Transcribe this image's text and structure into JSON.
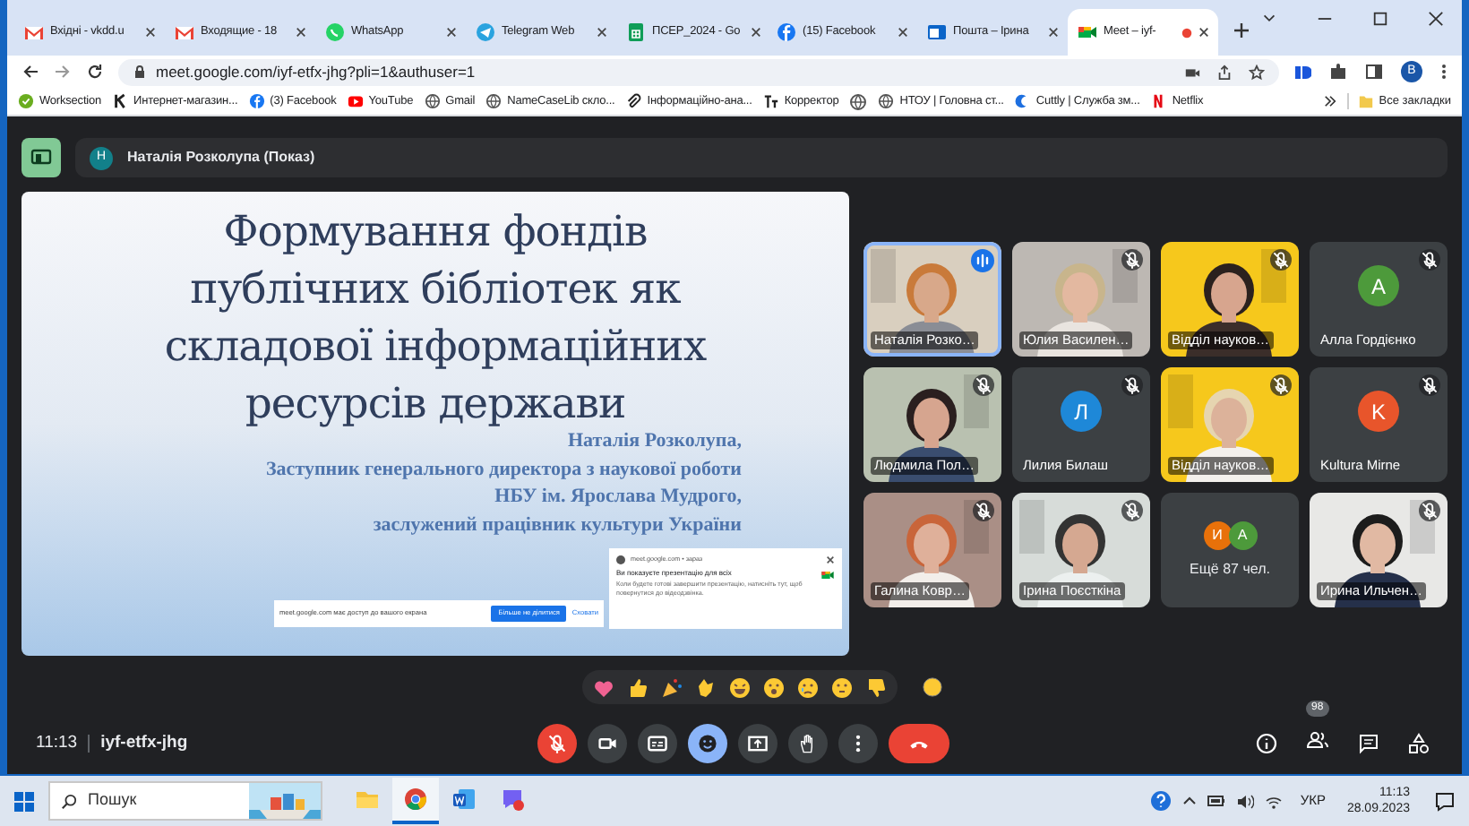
{
  "browser": {
    "tabs": [
      {
        "title": "Вхідні - vkdd.u",
        "selected": false
      },
      {
        "title": "Входящие - 18",
        "selected": false
      },
      {
        "title": "WhatsApp",
        "selected": false
      },
      {
        "title": "Telegram Web",
        "selected": false
      },
      {
        "title": "ПСЕР_2024 - Go",
        "selected": false
      },
      {
        "title": "(15) Facebook",
        "selected": false
      },
      {
        "title": "Пошта – Ірина",
        "selected": false
      },
      {
        "title": "Meet – iyf-",
        "selected": true
      }
    ],
    "url": "meet.google.com/iyf-etfx-jhg?pli=1&authuser=1",
    "profile_initial": "B",
    "bookmarks": [
      {
        "kind": "link",
        "title": "Worksection"
      },
      {
        "kind": "link",
        "title": "Интернет-магазин..."
      },
      {
        "kind": "link",
        "title": "(3) Facebook"
      },
      {
        "kind": "link",
        "title": "YouTube"
      },
      {
        "kind": "link",
        "title": "Gmail"
      },
      {
        "kind": "link",
        "title": "NameCaseLib скло..."
      },
      {
        "kind": "link",
        "title": "Інформаційно-ана..."
      },
      {
        "kind": "link",
        "title": "Корректор"
      },
      {
        "kind": "icon"
      },
      {
        "kind": "link",
        "title": "НТОУ | Головна ст..."
      },
      {
        "kind": "link",
        "title": "Cuttly | Служба зм..."
      },
      {
        "kind": "link",
        "title": "Netflix"
      }
    ],
    "all_bookmarks": "Все закладки"
  },
  "meet": {
    "presenter": {
      "initial": "Н",
      "name": "Наталія Розколупа (Показ)"
    },
    "slide": {
      "title": "Формування фондів\nпублічних бібліотек як\nскладової інформаційних\nресурсів держави",
      "subtitle": "Наталія Розколупа,\nЗаступник генерального директора з наукової роботи\nНБУ ім. Ярослава Мудрого,\nзаслужений працівник культури України"
    },
    "share_bar": {
      "text": "meet.google.com має доступ до вашого екрана",
      "stop": "Більше не ділитися",
      "hide": "Сховати"
    },
    "notification": {
      "source": "meet.google.com • зараз",
      "title": "Ви показуєте презентацію для всіх",
      "body": "Коли будете готові завершити презентацію, натисніть тут, щоб повернутися до відеодзвінка."
    },
    "tiles": [
      {
        "kind": "video",
        "name": "Наталія Розко…",
        "speaking": true,
        "muted": false
      },
      {
        "kind": "video",
        "name": "Юлия Василен…",
        "speaking": false,
        "muted": true
      },
      {
        "kind": "video",
        "name": "Відділ науков…",
        "speaking": false,
        "muted": true
      },
      {
        "kind": "avatar",
        "name": "Алла Гордієнко",
        "initial": "А",
        "color": "#4d9a3b",
        "speaking": false,
        "muted": true
      },
      {
        "kind": "video",
        "name": "Людмила Пол…",
        "speaking": false,
        "muted": true
      },
      {
        "kind": "avatar",
        "name": "Лилия Билаш",
        "initial": "Л",
        "color": "#1e88d8",
        "speaking": false,
        "muted": true
      },
      {
        "kind": "video",
        "name": "Відділ науков…",
        "speaking": false,
        "muted": true
      },
      {
        "kind": "avatar",
        "name": "Kultura Mirne",
        "initial": "K",
        "color": "#e8552b",
        "speaking": false,
        "muted": true
      },
      {
        "kind": "video",
        "name": "Галина Ковр…",
        "speaking": false,
        "muted": true
      },
      {
        "kind": "video",
        "name": "Ірина Поєсткіна",
        "speaking": false,
        "muted": true
      },
      {
        "kind": "more",
        "label": "Ещё 87 чел.",
        "avatars": [
          {
            "initial": "И",
            "color": "#e8710a"
          },
          {
            "initial": "А",
            "color": "#4d9a3b"
          }
        ]
      },
      {
        "kind": "video",
        "name": "Ирина Ильчен…",
        "speaking": false,
        "muted": true
      }
    ],
    "time": "11:13",
    "code": "iyf-etfx-jhg",
    "controls": [
      {
        "kind": "mic",
        "on": false
      },
      {
        "kind": "camera",
        "on": true
      },
      {
        "kind": "captions",
        "on": false
      },
      {
        "kind": "reactions",
        "on": true
      },
      {
        "kind": "present",
        "on": false
      },
      {
        "kind": "hand",
        "on": false
      },
      {
        "kind": "more"
      },
      {
        "kind": "end"
      }
    ],
    "people_count": "98"
  },
  "taskbar": {
    "search_placeholder": "Пошук",
    "apps": [
      {
        "selected": false
      },
      {
        "selected": true
      },
      {
        "selected": false
      },
      {
        "selected": false
      }
    ],
    "language": "УКР",
    "clock": "11:13",
    "date": "28.09.2023"
  }
}
